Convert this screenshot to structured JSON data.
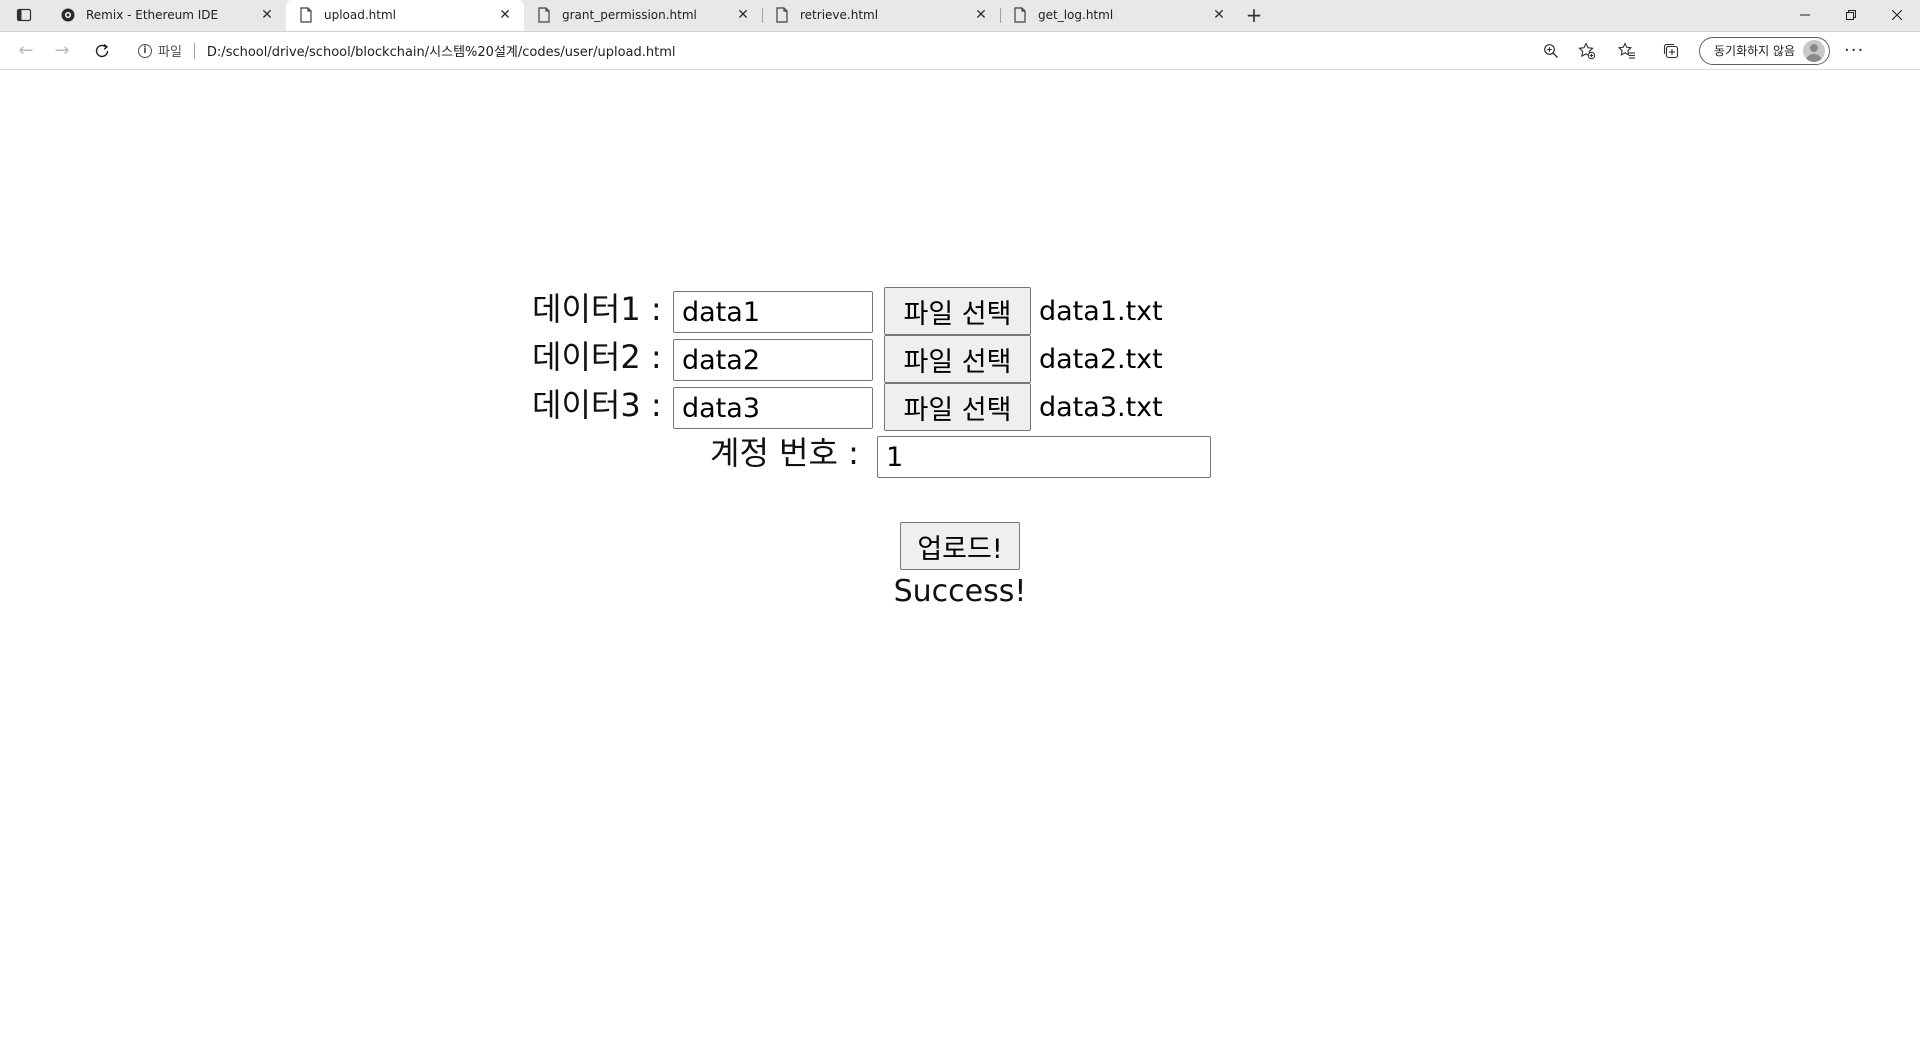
{
  "browser": {
    "tabs": [
      {
        "title": "Remix - Ethereum IDE",
        "icon": "remix-logo-icon",
        "active": false
      },
      {
        "title": "upload.html",
        "icon": "page-icon",
        "active": true
      },
      {
        "title": "grant_permission.html",
        "icon": "page-icon",
        "active": false
      },
      {
        "title": "retrieve.html",
        "icon": "page-icon",
        "active": false
      },
      {
        "title": "get_log.html",
        "icon": "page-icon",
        "active": false
      }
    ],
    "address": {
      "scheme_label": "파일",
      "url": "D:/school/drive/school/blockchain/시스템%20설계/codes/user/upload.html"
    },
    "profile_label": "동기화하지 않음"
  },
  "form": {
    "rows": [
      {
        "label": "데이터1 :",
        "value": "data1",
        "file_button": "파일 선택",
        "file_name": "data1.txt"
      },
      {
        "label": "데이터2 :",
        "value": "data2",
        "file_button": "파일 선택",
        "file_name": "data2.txt"
      },
      {
        "label": "데이터3 :",
        "value": "data3",
        "file_button": "파일 선택",
        "file_name": "data3.txt"
      }
    ],
    "account": {
      "label": "계정 번호 :",
      "value": "1"
    },
    "submit_label": "업로드!",
    "status": "Success!"
  }
}
